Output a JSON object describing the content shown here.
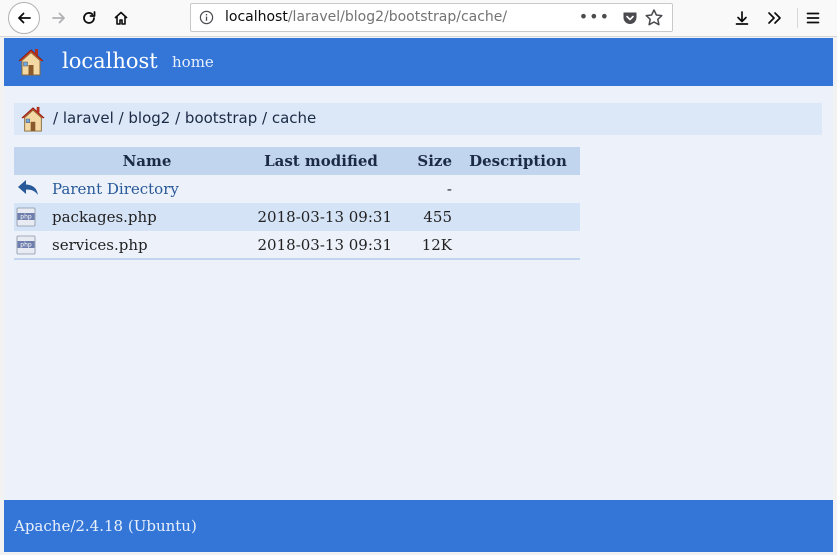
{
  "browser": {
    "url_host": "localhost",
    "url_path": "/laravel/blog2/bootstrap/cache/",
    "page_actions": "•••"
  },
  "site": {
    "brand": "localhost",
    "nav_home": "home"
  },
  "breadcrumb": {
    "path": "/ laravel / blog2 / bootstrap / cache"
  },
  "listing": {
    "headers": {
      "name": "Name",
      "last_modified": "Last modified",
      "size": "Size",
      "description": "Description"
    },
    "parent": {
      "name": "Parent Directory",
      "size": "-"
    },
    "files": [
      {
        "name": "packages.php",
        "last_modified": "2018-03-13 09:31",
        "size": "455",
        "description": "",
        "icon": "php-file-icon"
      },
      {
        "name": "services.php",
        "last_modified": "2018-03-13 09:31",
        "size": "12K",
        "description": "",
        "icon": "php-file-icon"
      }
    ]
  },
  "footer": {
    "server": "Apache/2.4.18 (Ubuntu)"
  },
  "colors": {
    "header_bg": "#3476d8",
    "page_bg": "#ecf1fa",
    "table_header_bg": "#c2d5ef",
    "row_alt_bg": "#d5e3f6"
  }
}
